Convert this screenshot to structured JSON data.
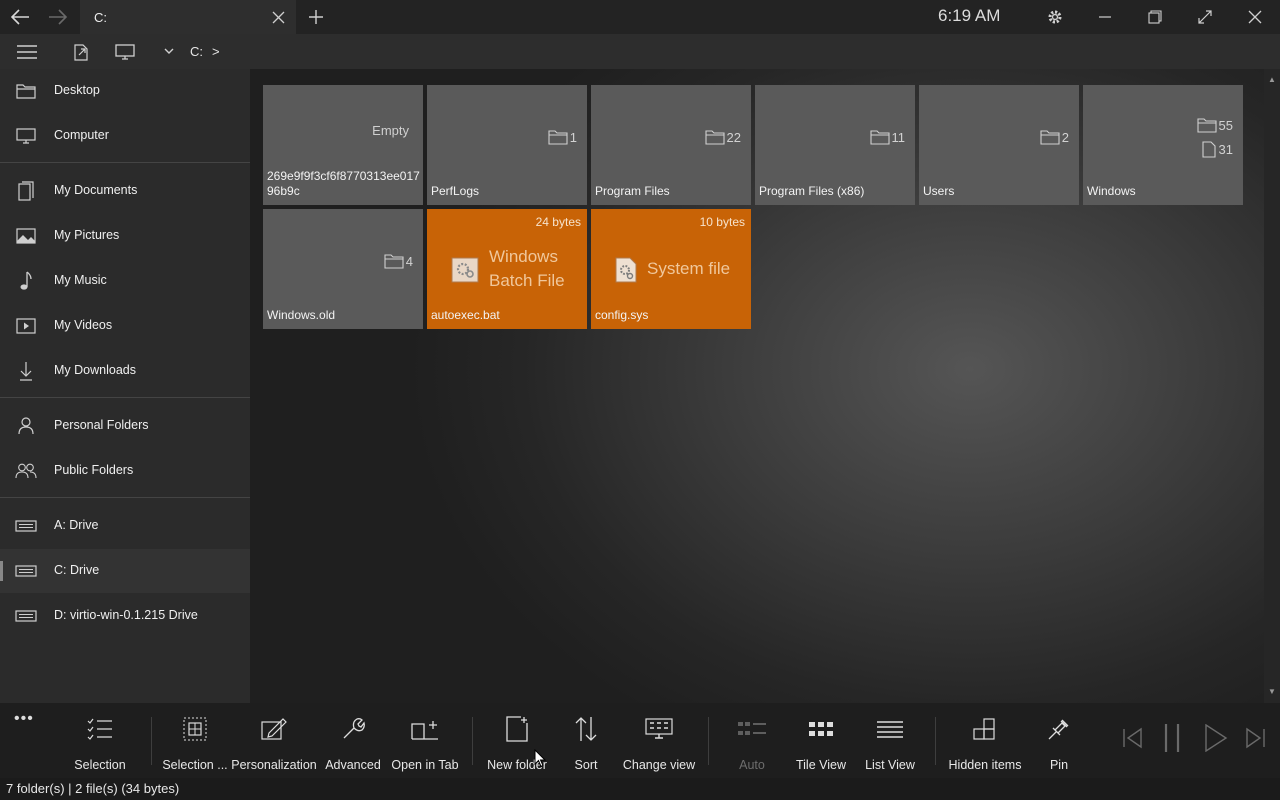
{
  "titlebar": {
    "tab_title": "C:",
    "clock": "6:19 AM",
    "icons": [
      "back-icon",
      "forward-icon",
      "close-tab-icon",
      "new-tab-icon",
      "settings-icon",
      "minimize-icon",
      "restore-icon",
      "fullscreen-icon",
      "close-window-icon"
    ]
  },
  "addressbar": {
    "crumb_drive": "C:",
    "crumb_sep": ">"
  },
  "sidebar": {
    "items": [
      {
        "label": "Desktop",
        "icon": "desktop-folder-icon"
      },
      {
        "label": "Computer",
        "icon": "computer-icon"
      },
      {
        "label": "My Documents",
        "icon": "documents-icon"
      },
      {
        "label": "My Pictures",
        "icon": "pictures-icon"
      },
      {
        "label": "My Music",
        "icon": "music-icon"
      },
      {
        "label": "My Videos",
        "icon": "videos-icon"
      },
      {
        "label": "My Downloads",
        "icon": "downloads-icon"
      },
      {
        "label": "Personal Folders",
        "icon": "person-icon"
      },
      {
        "label": "Public Folders",
        "icon": "people-icon"
      },
      {
        "label": "A:  Drive",
        "icon": "drive-icon"
      },
      {
        "label": "C:  Drive",
        "icon": "drive-icon"
      },
      {
        "label": "D: virtio-win-0.1.215 Drive",
        "icon": "drive-icon"
      }
    ],
    "selected": "C:  Drive"
  },
  "tiles": [
    {
      "name": "269e9f9f3cf6f8770313ee01796b9c",
      "kind": "folder",
      "empty_label": "Empty"
    },
    {
      "name": "PerfLogs",
      "kind": "folder",
      "folders": "1"
    },
    {
      "name": "Program Files",
      "kind": "folder",
      "folders": "22"
    },
    {
      "name": "Program Files (x86)",
      "kind": "folder",
      "folders": "11"
    },
    {
      "name": "Users",
      "kind": "folder",
      "folders": "2"
    },
    {
      "name": "Windows",
      "kind": "folder",
      "folders": "55",
      "files": "31"
    },
    {
      "name": "Windows.old",
      "kind": "folder",
      "folders": "4"
    },
    {
      "name": "autoexec.bat",
      "kind": "file",
      "size": "24 bytes",
      "type_line1": "Windows",
      "type_line2": "Batch File"
    },
    {
      "name": "config.sys",
      "kind": "file",
      "size": "10 bytes",
      "type_line1": "System file"
    }
  ],
  "appbar": {
    "more": "•••",
    "items": [
      {
        "label": "Selection",
        "icon": "selection-icon"
      },
      {
        "label": "Selection ...",
        "icon": "selection-grid-icon"
      },
      {
        "label": "Personalization",
        "icon": "personalization-icon"
      },
      {
        "label": "Advanced",
        "icon": "wrench-icon"
      },
      {
        "label": "Open in Tab",
        "icon": "open-in-tab-icon"
      },
      {
        "label": "New folder",
        "icon": "new-folder-icon"
      },
      {
        "label": "Sort",
        "icon": "sort-icon"
      },
      {
        "label": "Change view",
        "icon": "change-view-icon"
      },
      {
        "label": "Auto",
        "icon": "auto-view-icon"
      },
      {
        "label": "Tile View",
        "icon": "tile-view-icon"
      },
      {
        "label": "List View",
        "icon": "list-view-icon"
      },
      {
        "label": "Hidden items",
        "icon": "hidden-items-icon"
      },
      {
        "label": "Pin",
        "icon": "pin-icon"
      }
    ],
    "media_icons": [
      "skip-previous-icon",
      "pause-icon",
      "play-icon",
      "skip-next-icon"
    ]
  },
  "status": {
    "text": "7 folder(s)  |  2 file(s) (34 bytes)"
  },
  "colors": {
    "file_tile": "#c86306",
    "folder_tile": "#5a5a5a",
    "sidebar": "#2b2b2b"
  }
}
